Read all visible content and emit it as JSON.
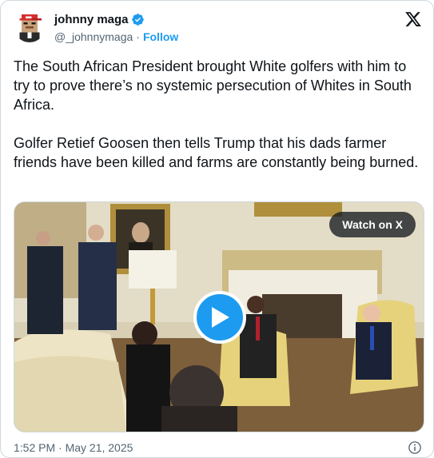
{
  "author": {
    "display_name": "johnny maga",
    "handle": "@_johnnymaga",
    "separator": "·",
    "follow_label": "Follow",
    "verified_icon": "verified-badge-icon",
    "avatar_icon": "pixel-avatar-red-cap"
  },
  "brand": {
    "logo_icon": "x-logo-icon"
  },
  "tweet": {
    "text": "The South African President brought White golfers with him to try to prove there’s no systemic persecution of Whites in South Africa.\n\nGolfer Retief Goosen then tells Trump that his dads farmer friends have been killed and farms are constantly being burned."
  },
  "media": {
    "type": "video",
    "watch_label": "Watch on X",
    "play_icon": "play-icon"
  },
  "footer": {
    "timestamp": "1:52 PM · May 21, 2025",
    "info_icon": "info-icon"
  },
  "colors": {
    "accent": "#1d9bf0",
    "text": "#0f1419",
    "secondary": "#536471",
    "border": "#cfd9de"
  }
}
